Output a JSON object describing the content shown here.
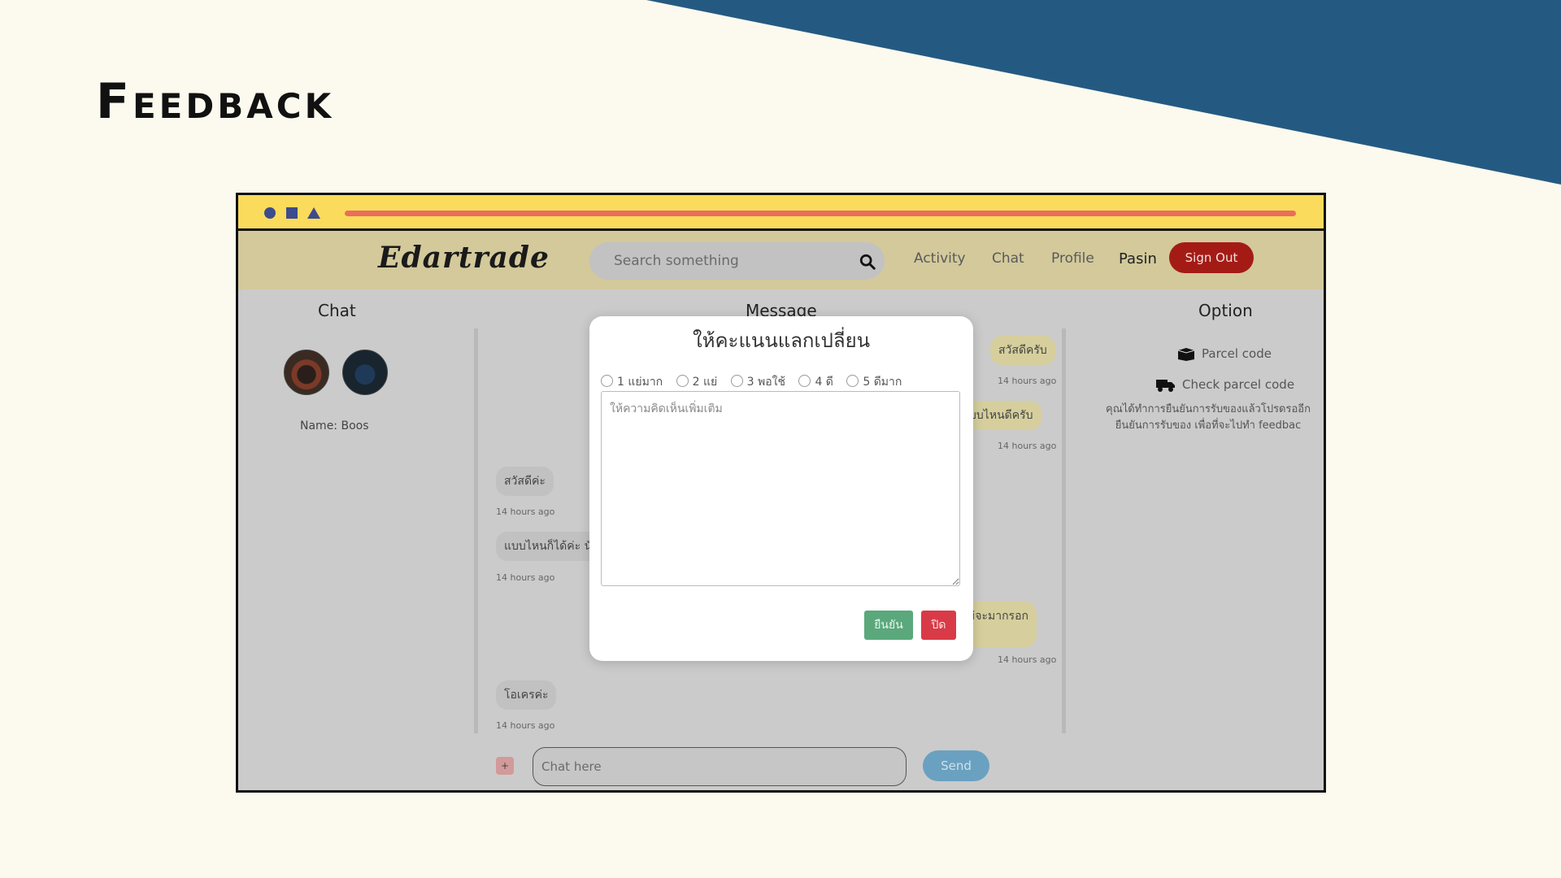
{
  "slide": {
    "title": "Feedback"
  },
  "colors": {
    "background": "#fcf9ee",
    "accent_band": "#245a82",
    "titlebar": "#fbdb5c",
    "navbar": "#d3c99b",
    "signout": "#a41b16",
    "confirm": "#5aa87c",
    "close": "#d93a47",
    "send": "#6aa1c0"
  },
  "navbar": {
    "logo": "Edartrade",
    "search_placeholder": "Search something",
    "search_icon": "search-icon",
    "items": [
      "Activity",
      "Chat",
      "Profile"
    ],
    "user": "Pasin",
    "signout_label": "Sign Out"
  },
  "chat_panel": {
    "title": "Chat",
    "name_label": "Name: Boos"
  },
  "message_panel": {
    "title": "Message",
    "messages": [
      {
        "side": "right",
        "text": "สวัสดีครับ",
        "time": "14 hours ago"
      },
      {
        "side": "right",
        "text": "แบบไหนดีครับ",
        "time": "14 hours ago"
      },
      {
        "side": "left",
        "text": "สวัสดีค่ะ",
        "time": "14 hours ago"
      },
      {
        "side": "left",
        "text": "แบบไหนก็ได้ค่ะ นัด",
        "time": "14 hours ago"
      },
      {
        "side": "right",
        "text": "ไม่จะมากรอก",
        "time": "14 hours ago"
      },
      {
        "side": "left",
        "text": "โอเครค่ะ",
        "time": "14 hours ago"
      }
    ],
    "attach_label": "+",
    "input_placeholder": "Chat here",
    "send_label": "Send"
  },
  "option_panel": {
    "title": "Option",
    "parcel_code": "Parcel code",
    "check_parcel_code": "Check parcel code",
    "note_line1": "คุณได้ทำการยืนยันการรับของแล้วโปรดรออีก",
    "note_line2": "ยืนยันการรับของ เพื่อที่จะไปทำ feedbac"
  },
  "modal": {
    "title": "ให้คะแนนแลกเปลี่ยน",
    "ratings": [
      "1 แย่มาก",
      "2 แย่",
      "3 พอใช้",
      "4 ดี",
      "5 ดีมาก"
    ],
    "comment_placeholder": "ให้ความคิดเห็นเพิ่มเติม",
    "confirm_label": "ยืนยัน",
    "close_label": "ปิด"
  }
}
